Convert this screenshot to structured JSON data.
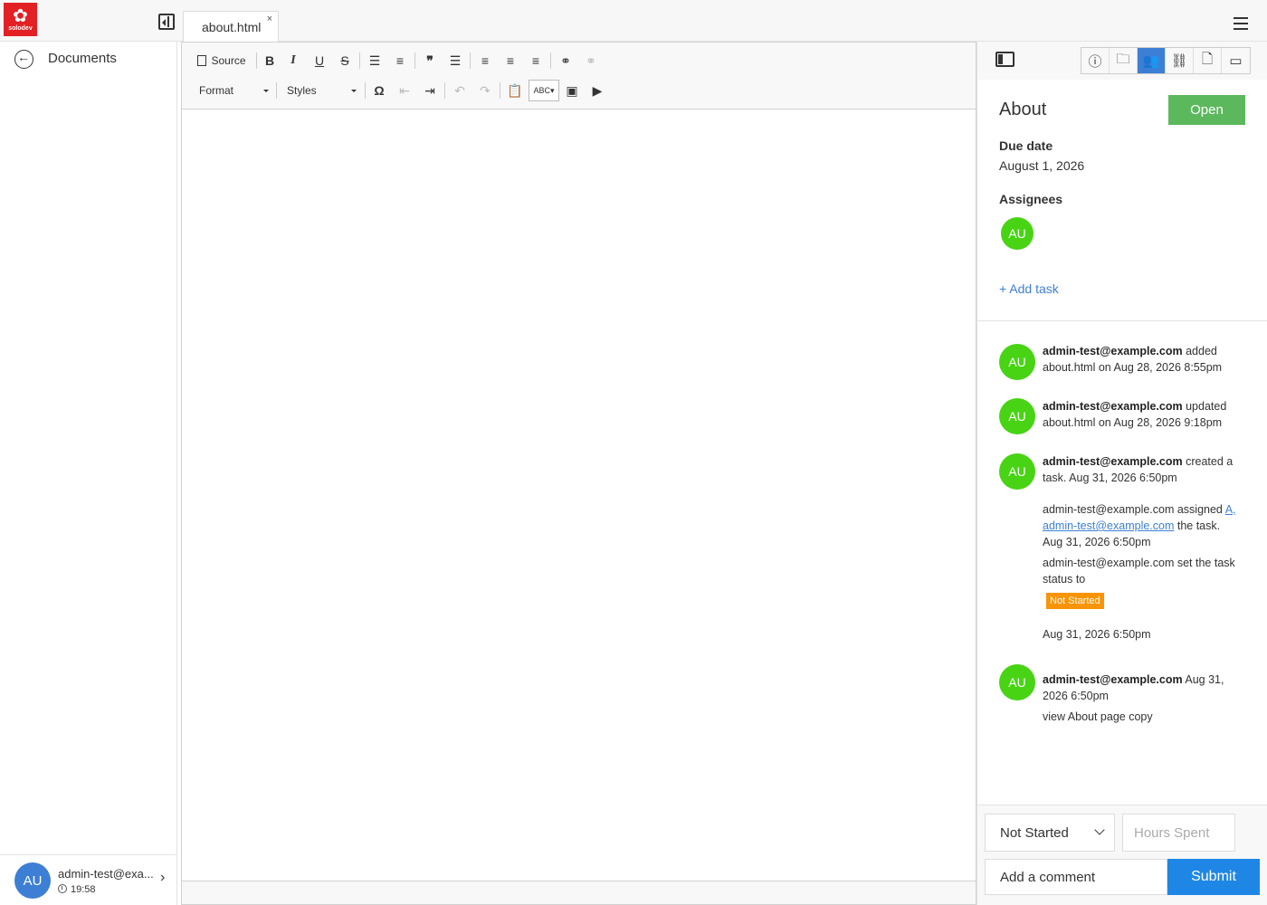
{
  "brand": {
    "logo_text": "solodev",
    "color": "#e32124"
  },
  "tab": {
    "label": "about.html",
    "close": "×"
  },
  "sidebar": {
    "back_label": "Documents",
    "user": {
      "initials": "AU",
      "email": "admin-test@exa...",
      "time": "19:58"
    }
  },
  "editor": {
    "toolbar": {
      "source_label": "Source",
      "bold": "B",
      "italic": "I",
      "underline": "U",
      "strike": "S",
      "format_label": "Format",
      "styles_label": "Styles",
      "omega": "Ω"
    }
  },
  "panel": {
    "title": "About",
    "status_button": "Open",
    "due_label": "Due date",
    "due_value": "August 1, 2026",
    "assignees_label": "Assignees",
    "assignee_initials": "AU",
    "add_task": "+ Add task",
    "activity": [
      {
        "initials": "AU",
        "user": "admin-test@example.com",
        "text": " added about.html on Aug 28, 2026 8:55pm"
      },
      {
        "initials": "AU",
        "user": "admin-test@example.com",
        "text": " updated about.html on Aug 28, 2026 9:18pm"
      },
      {
        "initials": "AU",
        "user": "admin-test@example.com",
        "text": " created a task. Aug 31, 2026 6:50pm"
      }
    ],
    "assign_event": {
      "prefix": "admin-test@example.com assigned ",
      "link1": "A,",
      "link2": "admin-test@example.com",
      "suffix": " the task.",
      "time": "Aug 31, 2026 6:50pm"
    },
    "status_event": {
      "text": "admin-test@example.com set the task status to",
      "badge": "Not Started",
      "time": "Aug 31, 2026 6:50pm"
    },
    "comment_event": {
      "initials": "AU",
      "user": "admin-test@example.com",
      "time": " Aug 31, 2026 6:50pm",
      "body": "view About page copy"
    },
    "footer": {
      "status_value": "Not Started",
      "hours_placeholder": "Hours Spent",
      "comment_placeholder": "Add a comment",
      "submit_label": "Submit"
    }
  },
  "colors": {
    "accent": "#3d7fd4",
    "avatar_green": "#48d414",
    "open_green": "#5cb85c",
    "badge_orange": "#f89406",
    "submit_blue": "#1e87e5"
  }
}
